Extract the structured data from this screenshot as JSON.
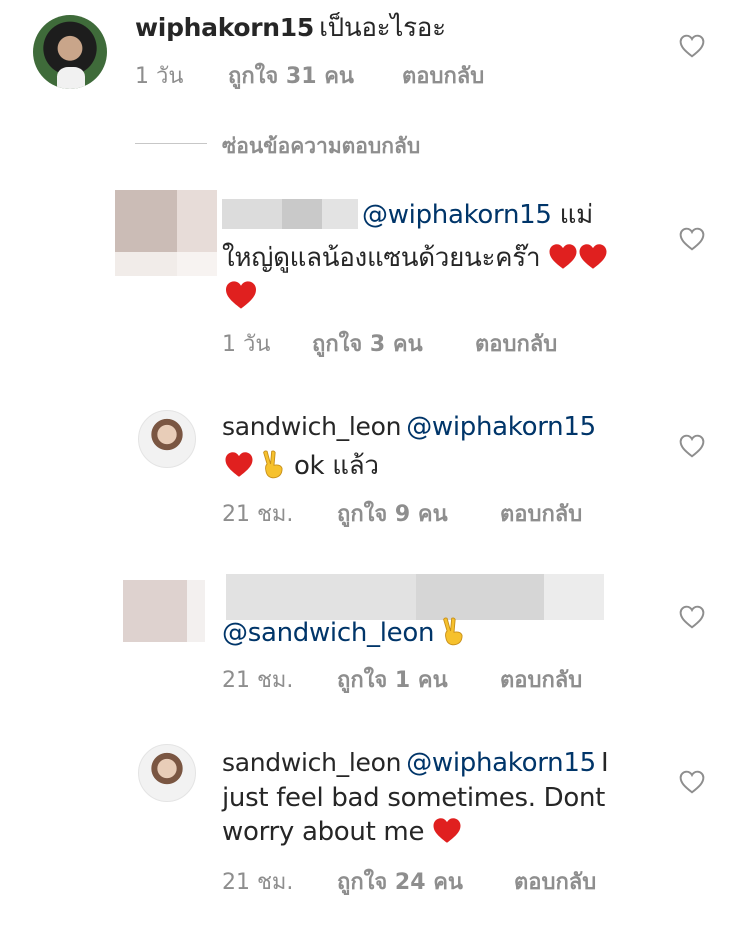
{
  "comments": [
    {
      "username": "wiphakorn15",
      "text": "เป็นอะไรอะ",
      "time": "1 วัน",
      "likes": "ถูกใจ 31 คน",
      "reply": "ตอบกลับ"
    },
    {
      "mention": "@wiphakorn15",
      "text_line1": "แม่",
      "text_line2": "ใหญ่ดูแลน้องแซนด้วยนะคร๊า",
      "time": "1 วัน",
      "likes": "ถูกใจ 3 คน",
      "reply": "ตอบกลับ"
    },
    {
      "username": "sandwich_leon",
      "mention": "@wiphakorn15",
      "text": "ok แล้ว",
      "time": "21 ชม.",
      "likes": "ถูกใจ 9 คน",
      "reply": "ตอบกลับ"
    },
    {
      "mention": "@sandwich_leon",
      "time": "21 ชม.",
      "likes": "ถูกใจ 1 คน",
      "reply": "ตอบกลับ"
    },
    {
      "username": "sandwich_leon",
      "mention": "@wiphakorn15",
      "text_line1": "I",
      "text_line2": "just feel bad sometimes.  Dont",
      "text_line3": "worry about me",
      "time": "21 ชม.",
      "likes": "ถูกใจ 24 คน",
      "reply": "ตอบกลับ"
    }
  ],
  "hide_replies": "ซ่อนข้อความตอบกลับ",
  "icons": {
    "like": "heart-outline-icon",
    "emoji_heart": "red-heart-emoji",
    "emoji_peace": "victory-hand-emoji"
  },
  "colors": {
    "mention": "#003569",
    "meta": "#8e8e8e",
    "heart_red": "#e0201f"
  }
}
